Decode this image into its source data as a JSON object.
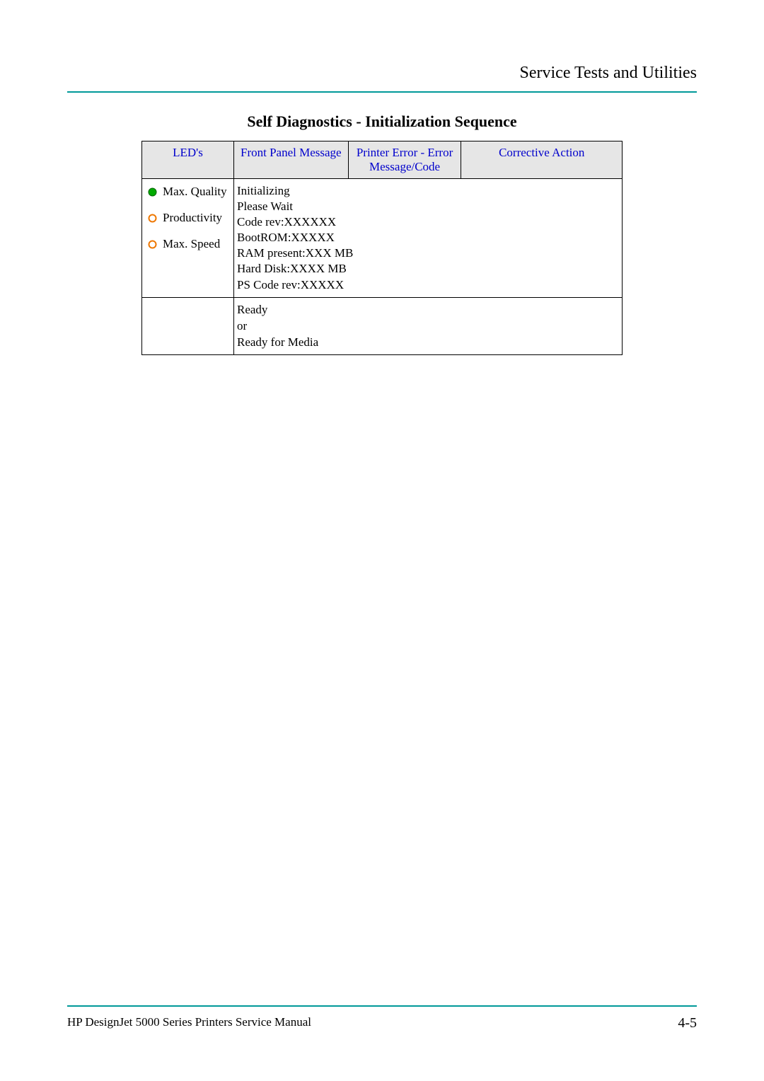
{
  "header": {
    "section_title": "Service Tests and Utilities"
  },
  "table": {
    "title": "Self Diagnostics - Initialization Sequence",
    "headers": {
      "leds": "LED's",
      "front_panel_message": "Front Panel Message",
      "printer_error": "Printer Error - Error Message/Code",
      "corrective_action": "Corrective Action"
    },
    "leds": {
      "max_quality": "Max. Quality",
      "productivity": "Productivity",
      "max_speed": "Max. Speed"
    },
    "messages": {
      "line1": "Initializing",
      "line2": "Please Wait",
      "line3": "Code rev:XXXXXX",
      "line4": "BootROM:XXXXX",
      "line5": "RAM present:XXX MB",
      "line6": "Hard Disk:XXXX MB",
      "line7": "PS Code rev:XXXXX"
    },
    "ready": {
      "line1": "Ready",
      "line2": "or",
      "line3": "Ready for Media"
    }
  },
  "footer": {
    "manual_title": "HP DesignJet 5000 Series Printers Service Manual",
    "page_number": "4-5"
  }
}
